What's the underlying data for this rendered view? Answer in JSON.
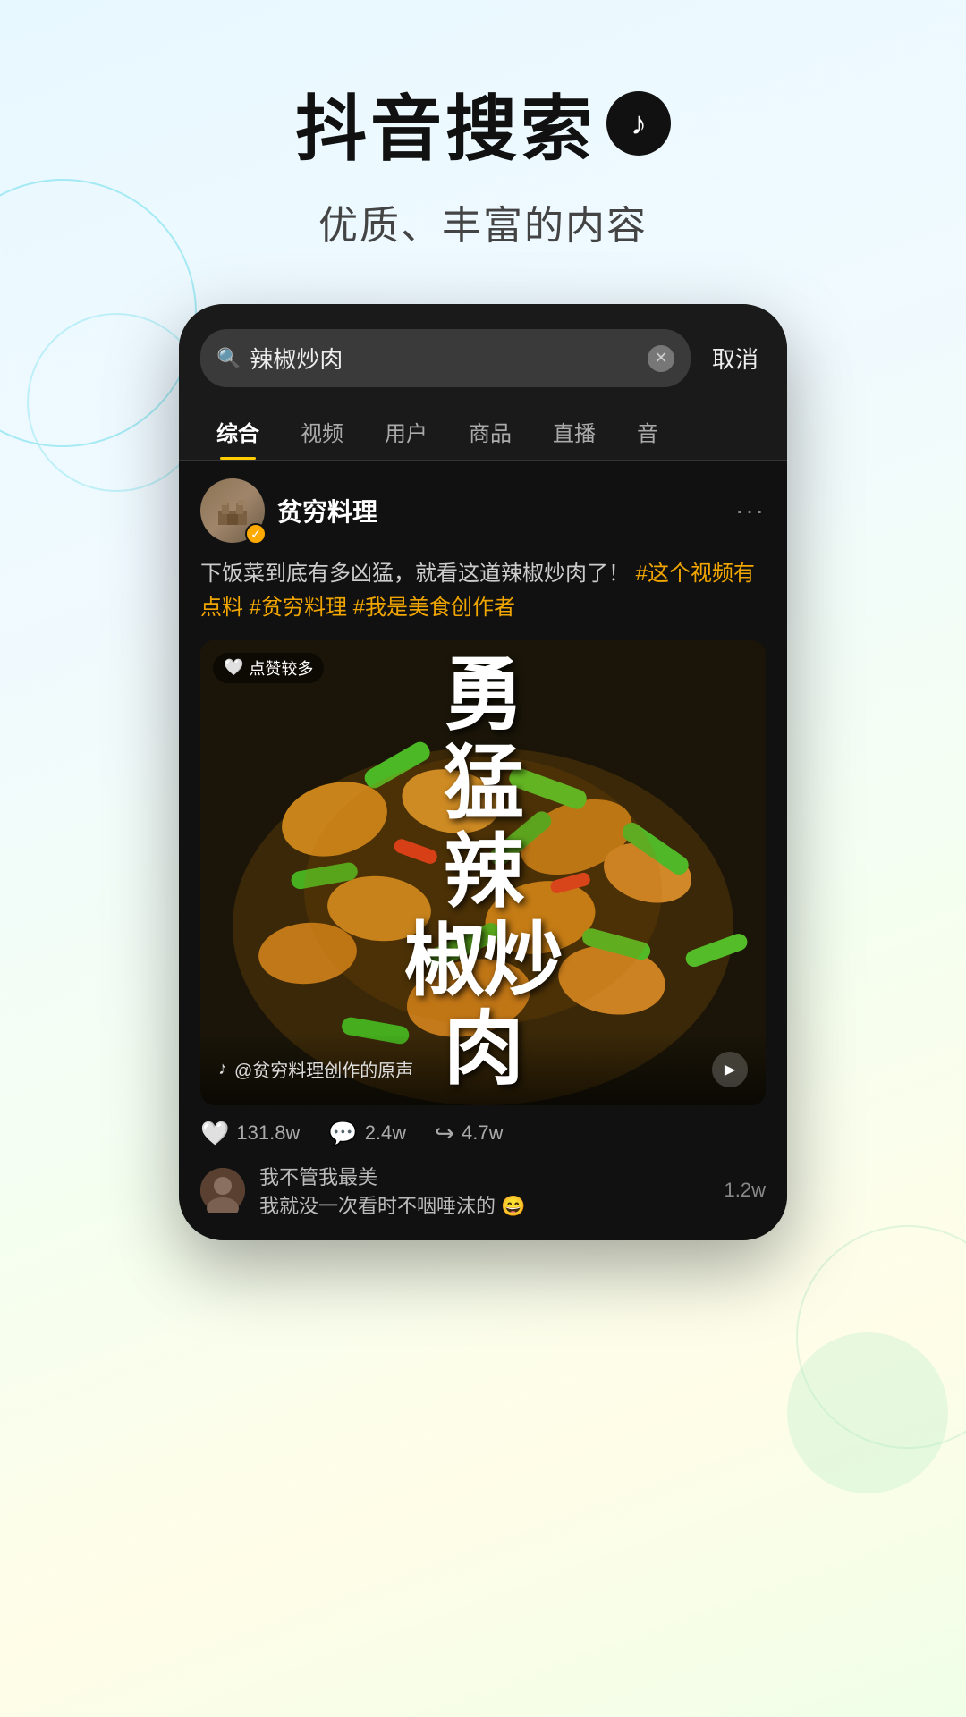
{
  "header": {
    "main_title": "抖音搜索",
    "subtitle": "优质、丰富的内容"
  },
  "phone": {
    "search": {
      "query": "辣椒炒肉",
      "cancel_label": "取消"
    },
    "tabs": [
      {
        "id": "comprehensive",
        "label": "综合",
        "active": true
      },
      {
        "id": "video",
        "label": "视频",
        "active": false
      },
      {
        "id": "user",
        "label": "用户",
        "active": false
      },
      {
        "id": "goods",
        "label": "商品",
        "active": false
      },
      {
        "id": "live",
        "label": "直播",
        "active": false
      },
      {
        "id": "audio",
        "label": "音",
        "active": false
      }
    ],
    "post": {
      "user": {
        "name": "贫穷料理",
        "verified": true
      },
      "text": "下饭菜到底有多凶猛，就看这道辣椒炒肉了！",
      "hashtags": [
        "#这个视频有点料",
        "#贫穷料理",
        "#我是美食创作者"
      ],
      "video": {
        "badge": "点赞较多",
        "overlay_text": "勇猛辣椒炒肉",
        "overlay_text_lines": [
          "勇",
          "猛",
          "辣",
          "椒炒",
          "肉"
        ],
        "source": "@贫穷料理创作的原声",
        "calligraphy": "勇\n猛\n辣\n椒炒\n肉"
      },
      "actions": {
        "likes": "131.8w",
        "comments": "2.4w",
        "shares": "4.7w"
      },
      "comment_preview": {
        "user": "我不管我最美",
        "text": "我就没一次看时不咽唾沫的 😄",
        "count": "1.2w"
      }
    }
  }
}
